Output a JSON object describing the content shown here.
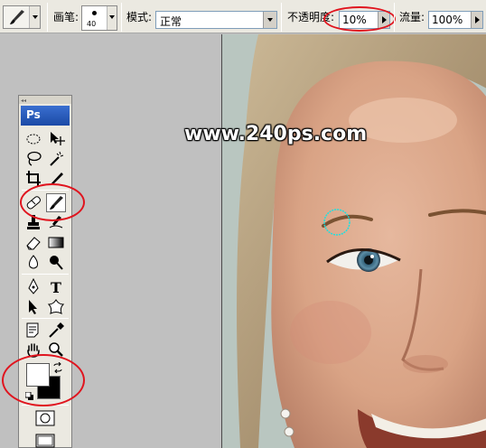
{
  "options_bar": {
    "tool_preset_icon": "brush-icon",
    "brush_label": "画笔:",
    "brush_size": "40",
    "mode_label": "模式:",
    "mode_value": "正常",
    "opacity_label": "不透明度:",
    "opacity_value": "10%",
    "flow_label": "流量:",
    "flow_value": "100%"
  },
  "toolbox": {
    "logo": "Ps",
    "tools": [
      "marquee-icon",
      "move-icon",
      "lasso-icon",
      "magic-wand-icon",
      "crop-icon",
      "slice-icon",
      "healing-brush-icon",
      "brush-icon",
      "clone-stamp-icon",
      "history-brush-icon",
      "eraser-icon",
      "gradient-icon",
      "blur-icon",
      "dodge-icon",
      "path-selection-icon",
      "type-icon",
      "pen-icon",
      "custom-shape-icon",
      "notes-icon",
      "eyedropper-icon",
      "hand-icon",
      "zoom-icon"
    ],
    "foreground_color": "#ffffff",
    "background_color": "#000000"
  },
  "canvas": {
    "watermark": "www.240ps.com"
  },
  "colors": {
    "annotation_red": "#e0141e",
    "photoshop_blue": "#1b4aa6"
  }
}
